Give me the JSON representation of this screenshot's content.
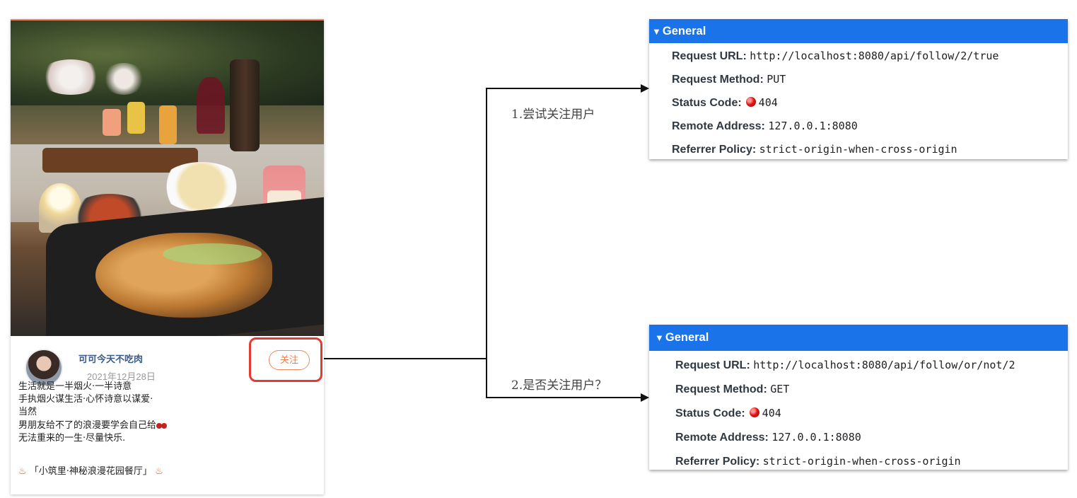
{
  "post": {
    "author_name": "可可今天不吃肉",
    "date": "2021年12月28日",
    "follow_label": "关注",
    "content_lines": [
      "生活就是一半烟火·一半诗意",
      "手执烟火谋生活·心怀诗意以谋爱·",
      "当然",
      "男朋友给不了的浪漫要学会自己给",
      "无法重来的一生·尽量快乐."
    ],
    "tail": "「小筑里·神秘浪漫花园餐厅」"
  },
  "steps": {
    "step1": "1.尝试关注用户",
    "step2": "2.是否关注用户？"
  },
  "panel1": {
    "header": "General",
    "request_url_key": "Request URL:",
    "request_url": "http://localhost:8080/api/follow/2/true",
    "request_method_key": "Request Method:",
    "request_method": "PUT",
    "status_code_key": "Status Code:",
    "status_code": "404",
    "remote_address_key": "Remote Address:",
    "remote_address": "127.0.0.1:8080",
    "referrer_policy_key": "Referrer Policy:",
    "referrer_policy": "strict-origin-when-cross-origin"
  },
  "panel2": {
    "header": "General",
    "request_url_key": "Request URL:",
    "request_url": "http://localhost:8080/api/follow/or/not/2",
    "request_method_key": "Request Method:",
    "request_method": "GET",
    "status_code_key": "Status Code:",
    "status_code": "404",
    "remote_address_key": "Remote Address:",
    "remote_address": "127.0.0.1:8080",
    "referrer_policy_key": "Referrer Policy:",
    "referrer_policy": "strict-origin-when-cross-origin"
  },
  "colors": {
    "header_blue": "#1a73e8",
    "follow_orange": "#ee7a4a",
    "highlight_red": "#e33b33",
    "status_red": "#e01818"
  }
}
